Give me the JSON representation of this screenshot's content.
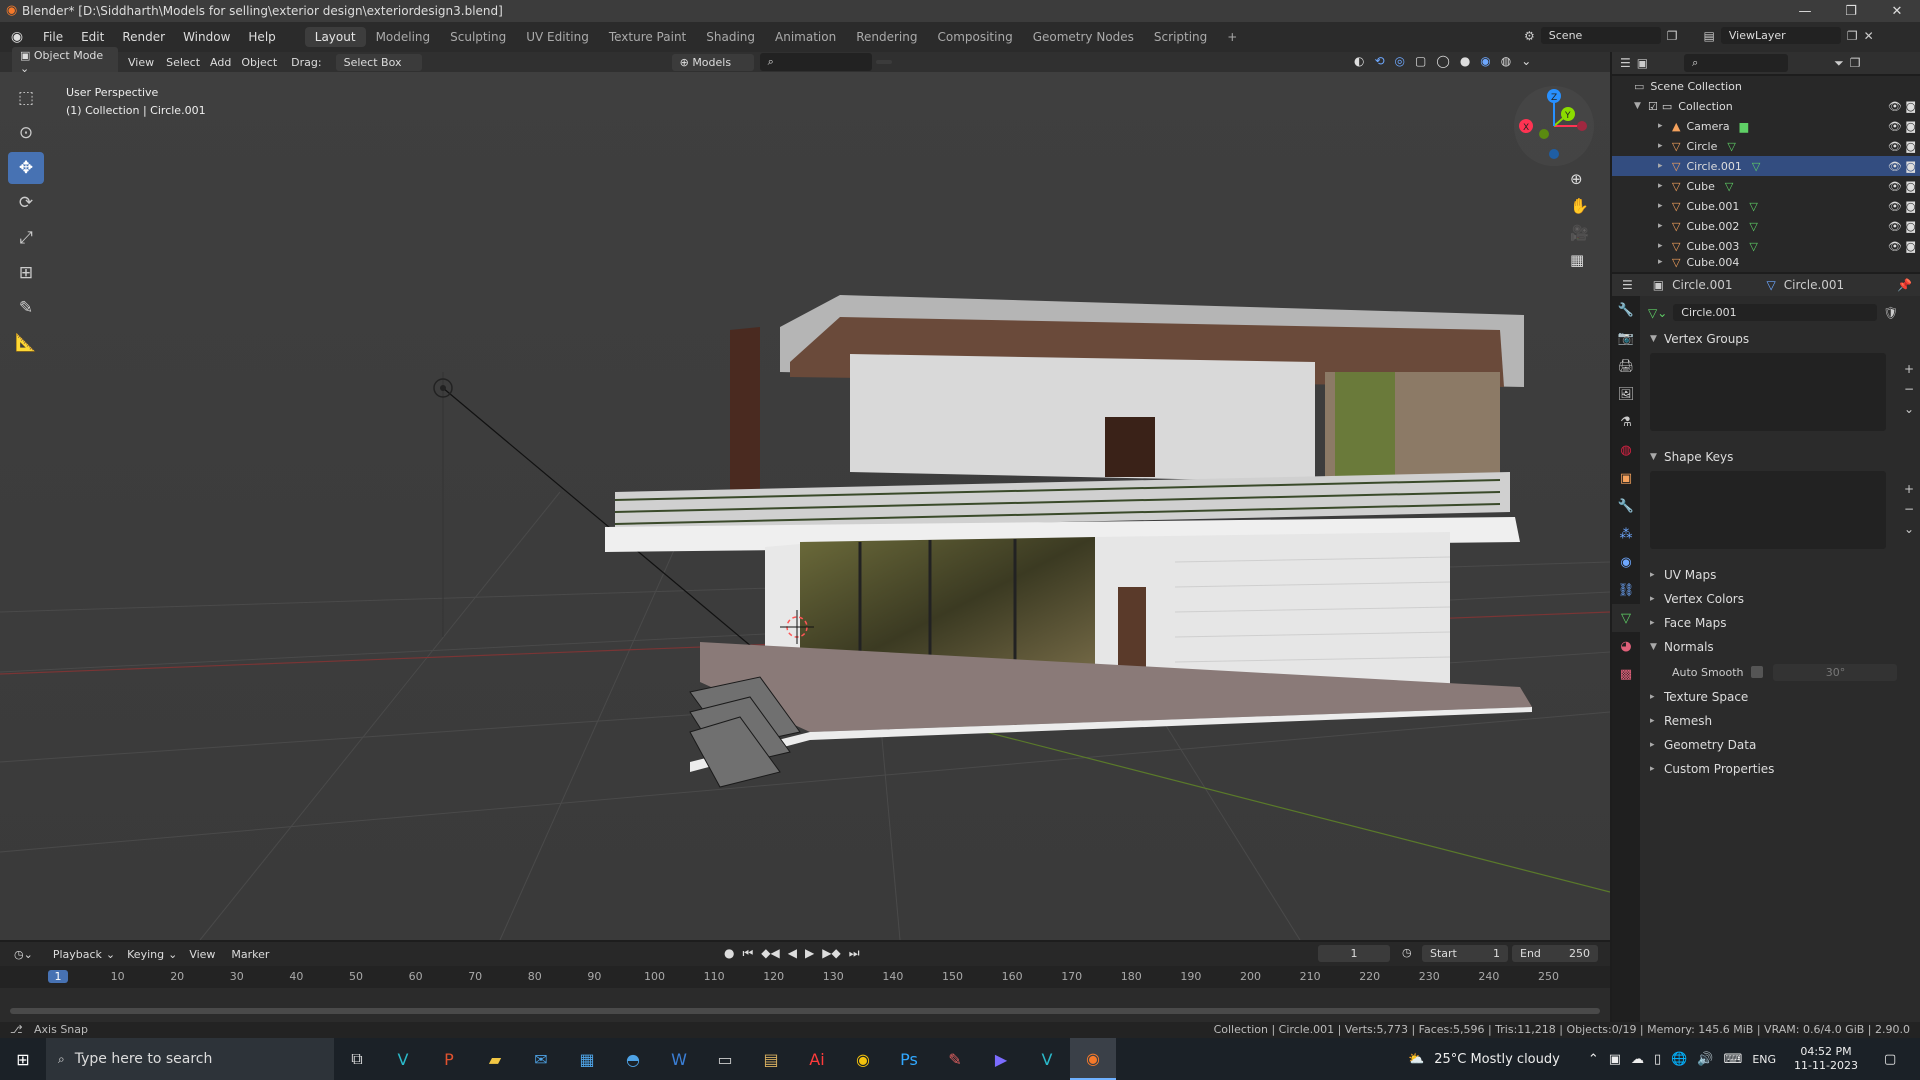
{
  "window": {
    "title": "Blender* [D:\\Siddharth\\Models for selling\\exterior design\\exteriordesign3.blend]"
  },
  "menu": {
    "items": [
      "File",
      "Edit",
      "Render",
      "Window",
      "Help"
    ]
  },
  "workspaces": [
    "Layout",
    "Modeling",
    "Sculpting",
    "UV Editing",
    "Texture Paint",
    "Shading",
    "Animation",
    "Rendering",
    "Compositing",
    "Geometry Nodes",
    "Scripting"
  ],
  "scene": {
    "label": "Scene",
    "view_layer": "ViewLayer"
  },
  "viewport_header": {
    "mode": "Object Mode",
    "menus": [
      "View",
      "Select",
      "Add",
      "Object"
    ],
    "drag_label": "Drag:",
    "drag_value": "Select Box",
    "orientation": "Models"
  },
  "viewport": {
    "perspective": "User Perspective",
    "collection_info": "(1) Collection | Circle.001"
  },
  "outliner": {
    "scene_collection": "Scene Collection",
    "collection": "Collection",
    "items": [
      "Camera",
      "Circle",
      "Circle.001",
      "Cube",
      "Cube.001",
      "Cube.002",
      "Cube.003",
      "Cube.004"
    ]
  },
  "properties": {
    "object_name": "Circle.001",
    "data_name": "Circle.001",
    "mesh_name": "Circle.001",
    "panels": {
      "vertex_groups": "Vertex Groups",
      "shape_keys": "Shape Keys",
      "uv_maps": "UV Maps",
      "vertex_colors": "Vertex Colors",
      "face_maps": "Face Maps",
      "normals": "Normals",
      "auto_smooth": "Auto Smooth",
      "auto_smooth_angle": "30°",
      "texture_space": "Texture Space",
      "remesh": "Remesh",
      "geometry_data": "Geometry Data",
      "custom_properties": "Custom Properties"
    }
  },
  "timeline": {
    "menus": [
      "Playback",
      "Keying",
      "View",
      "Marker"
    ],
    "current_frame": "1",
    "start_label": "Start",
    "start": "1",
    "end_label": "End",
    "end": "250",
    "ticks": [
      "1",
      "10",
      "20",
      "30",
      "40",
      "50",
      "60",
      "70",
      "80",
      "90",
      "100",
      "110",
      "120",
      "130",
      "140",
      "150",
      "160",
      "170",
      "180",
      "190",
      "200",
      "210",
      "220",
      "230",
      "240",
      "250"
    ]
  },
  "status": {
    "left": "Axis Snap",
    "right": "Collection | Circle.001 | Verts:5,773 | Faces:5,596 | Tris:11,218 | Objects:0/19 | Memory: 145.6 MiB | VRAM: 0.6/4.0 GiB | 2.90.0"
  },
  "taskbar": {
    "search_placeholder": "Type here to search",
    "weather": "25°C  Mostly cloudy",
    "lang": "ENG",
    "time": "04:52 PM",
    "date": "11-11-2023"
  },
  "colors": {
    "accent": "#4772b3",
    "axis_x": "#ff3352",
    "axis_y": "#8bdc00",
    "axis_z": "#2890ff"
  }
}
